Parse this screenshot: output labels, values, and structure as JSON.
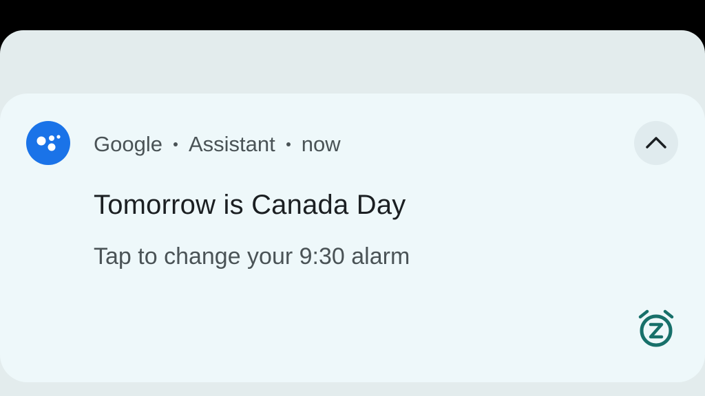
{
  "notification": {
    "app_name": "Google",
    "sub_app": "Assistant",
    "time": "now",
    "title": "Tomorrow is Canada Day",
    "body": "Tap to change your 9:30 alarm",
    "app_icon": "google-assistant-icon",
    "expand_icon": "chevron-up-icon",
    "action_icon": "alarm-snooze-icon"
  },
  "colors": {
    "accent_blue": "#1a73e8",
    "action_teal": "#17706a",
    "card_background": "#eef8fa",
    "shade_background": "#e3eced"
  }
}
